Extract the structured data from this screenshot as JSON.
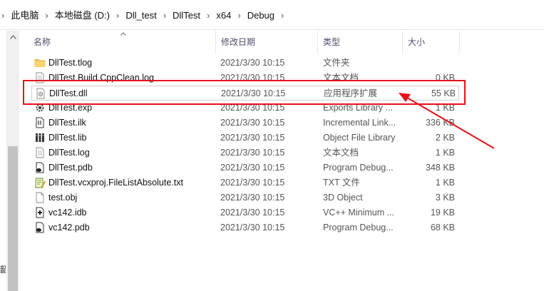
{
  "breadcrumb": {
    "items": [
      "此电脑",
      "本地磁盘 (D:)",
      "Dll_test",
      "DllTest",
      "x64",
      "Debug"
    ]
  },
  "columns": {
    "name": "名称",
    "date": "修改日期",
    "type": "类型",
    "size": "大小"
  },
  "nav_fragment": "韶",
  "files": [
    {
      "name": "DllTest.tlog",
      "date": "2021/3/30 10:15",
      "type": "文件夹",
      "size": "",
      "icon": "folder-icon"
    },
    {
      "name": "DllTest.Build.CppClean.log",
      "date": "2021/3/30 10:15",
      "type": "文本文档",
      "size": "0 KB",
      "icon": "text-file-icon"
    },
    {
      "name": "DllTest.dll",
      "date": "2021/3/30 10:15",
      "type": "应用程序扩展",
      "size": "55 KB",
      "icon": "dll-file-icon"
    },
    {
      "name": "DllTest.exp",
      "date": "2021/3/30 10:15",
      "type": "Exports Library ...",
      "size": "1 KB",
      "icon": "exp-file-icon"
    },
    {
      "name": "DllTest.ilk",
      "date": "2021/3/30 10:15",
      "type": "Incremental Link...",
      "size": "336 KB",
      "icon": "ilk-file-icon"
    },
    {
      "name": "DllTest.lib",
      "date": "2021/3/30 10:15",
      "type": "Object File Library",
      "size": "2 KB",
      "icon": "lib-file-icon"
    },
    {
      "name": "DllTest.log",
      "date": "2021/3/30 10:15",
      "type": "文本文档",
      "size": "1 KB",
      "icon": "text-file-icon"
    },
    {
      "name": "DllTest.pdb",
      "date": "2021/3/30 10:15",
      "type": "Program Debug...",
      "size": "348 KB",
      "icon": "pdb-file-icon"
    },
    {
      "name": "DllTest.vcxproj.FileListAbsolute.txt",
      "date": "2021/3/30 10:15",
      "type": "TXT 文件",
      "size": "1 KB",
      "icon": "txt-file-icon"
    },
    {
      "name": "test.obj",
      "date": "2021/3/30 10:15",
      "type": "3D Object",
      "size": "3 KB",
      "icon": "obj-file-icon"
    },
    {
      "name": "vc142.idb",
      "date": "2021/3/30 10:15",
      "type": "VC++ Minimum ...",
      "size": "19 KB",
      "icon": "idb-file-icon"
    },
    {
      "name": "vc142.pdb",
      "date": "2021/3/30 10:15",
      "type": "Program Debug...",
      "size": "68 KB",
      "icon": "pdb-file-icon"
    }
  ],
  "annotation": {
    "color": "#e5121b",
    "highlighted_item": "DllTest.dll"
  }
}
